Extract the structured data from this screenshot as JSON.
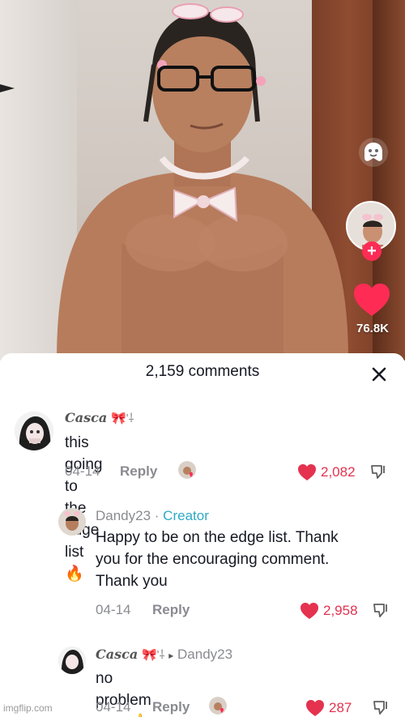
{
  "video": {
    "like_count": "76.8K",
    "follow_symbol": "+"
  },
  "comments_sheet": {
    "title": "2,159 comments",
    "close_symbol": "✕",
    "comments": [
      {
        "author": "Casca",
        "author_decor": "🎀'⸸",
        "text": "this going to the edge list 🔥",
        "date": "04-14",
        "reply_label": "Reply",
        "likes": "2,082"
      },
      {
        "author": "Dandy23",
        "author_sep": " · ",
        "role": "Creator",
        "text_lines": [
          "Happy to be on the edge list. Thank",
          "you for the encouraging comment.",
          "Thank you"
        ],
        "date": "04-14",
        "reply_label": "Reply",
        "likes": "2,958"
      },
      {
        "author": "Casca",
        "author_decor": "🎀'⸸",
        "reply_arrow": "▸",
        "reply_to": "Dandy23",
        "text": "no problem man 👍",
        "date": "04-14",
        "reply_label": "Reply",
        "likes": "287"
      }
    ]
  },
  "watermark": "imgflip.com",
  "colors": {
    "accent_red": "#fe2c55",
    "creator_blue": "#2fa9c6",
    "meta_gray": "#8a8b91"
  }
}
